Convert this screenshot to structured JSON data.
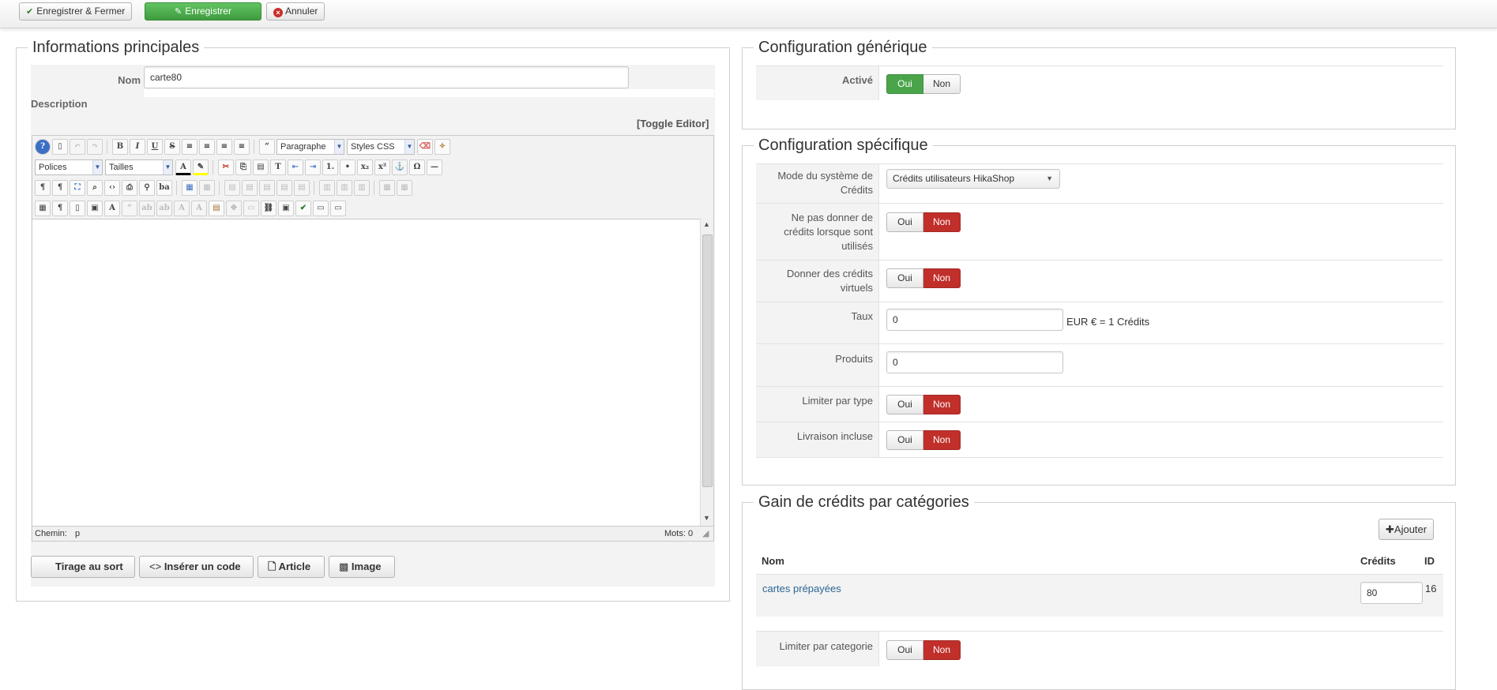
{
  "toolbar": {
    "save_close": "Enregistrer & Fermer",
    "save": "Enregistrer",
    "cancel": "Annuler"
  },
  "main": {
    "legend": "Informations principales",
    "name_label": "Nom",
    "name_value": "carte80",
    "description_label": "Description",
    "toggle_editor": "[Toggle Editor]",
    "editor": {
      "format_select": "Paragraphe",
      "styles_select": "Styles CSS",
      "font_select": "Polices",
      "size_select": "Tailles",
      "path_label": "Chemin:",
      "path_value": "p",
      "words_label": "Mots: 0"
    },
    "buttons": {
      "draw": "Tirage au sort",
      "insert_code": "Insérer un code",
      "article": "Article",
      "image": "Image"
    }
  },
  "generic": {
    "legend": "Configuration générique",
    "active_label": "Activé",
    "yes": "Oui",
    "no": "Non"
  },
  "specific": {
    "legend": "Configuration spécifique",
    "mode_label": "Mode du système de Crédits",
    "mode_value": "Crédits utilisateurs HikaShop",
    "no_credits_label": "Ne pas donner de crédits lorsque sont utilisés",
    "virtual_label": "Donner des crédits virtuels",
    "rate_label": "Taux",
    "rate_value": "0",
    "rate_suffix": "EUR € = 1 Crédits",
    "products_label": "Produits",
    "products_value": "0",
    "limit_type_label": "Limiter par type",
    "shipping_label": "Livraison incluse",
    "yes": "Oui",
    "no": "Non"
  },
  "categories": {
    "legend": "Gain de crédits par catégories",
    "add_button": "Ajouter",
    "col_name": "Nom",
    "col_credits": "Crédits",
    "col_id": "ID",
    "rows": [
      {
        "name": "cartes prépayées",
        "credits": "80",
        "id": "16"
      }
    ],
    "limit_label": "Limiter par categorie",
    "yes": "Oui",
    "no": "Non"
  },
  "colors": {
    "green": "#4aa54a",
    "red": "#c02f2a",
    "link": "#2a6496"
  }
}
